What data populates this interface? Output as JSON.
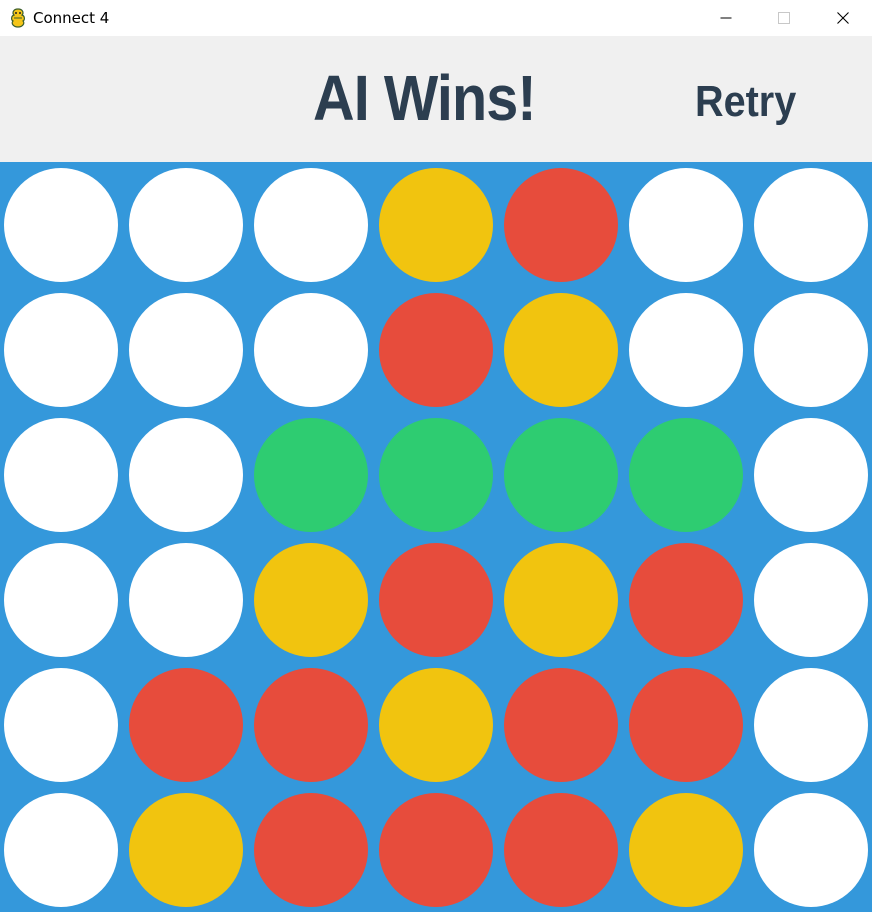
{
  "window": {
    "title": "Connect 4",
    "app_icon": "pygame-snake-icon",
    "controls": [
      "minimize-icon",
      "maximize-icon",
      "close-icon"
    ]
  },
  "header": {
    "status": "AI Wins!",
    "retry_label": "Retry"
  },
  "colors": {
    "board": "#3498db",
    "banner": "#f0f0f0",
    "text": "#2c3e50",
    "empty": "#ffffff",
    "red": "#e74c3c",
    "yellow": "#f1c40f",
    "green": "#2ecc71"
  },
  "board": {
    "rows": 6,
    "cols": 7,
    "legend": {
      "E": "empty",
      "R": "red",
      "Y": "yellow",
      "G": "green"
    },
    "grid": [
      [
        "E",
        "E",
        "E",
        "Y",
        "R",
        "E",
        "E"
      ],
      [
        "E",
        "E",
        "E",
        "R",
        "Y",
        "E",
        "E"
      ],
      [
        "E",
        "E",
        "G",
        "G",
        "G",
        "G",
        "E"
      ],
      [
        "E",
        "E",
        "Y",
        "R",
        "Y",
        "R",
        "E"
      ],
      [
        "E",
        "R",
        "R",
        "Y",
        "R",
        "R",
        "E"
      ],
      [
        "E",
        "Y",
        "R",
        "R",
        "R",
        "Y",
        "E"
      ]
    ]
  }
}
